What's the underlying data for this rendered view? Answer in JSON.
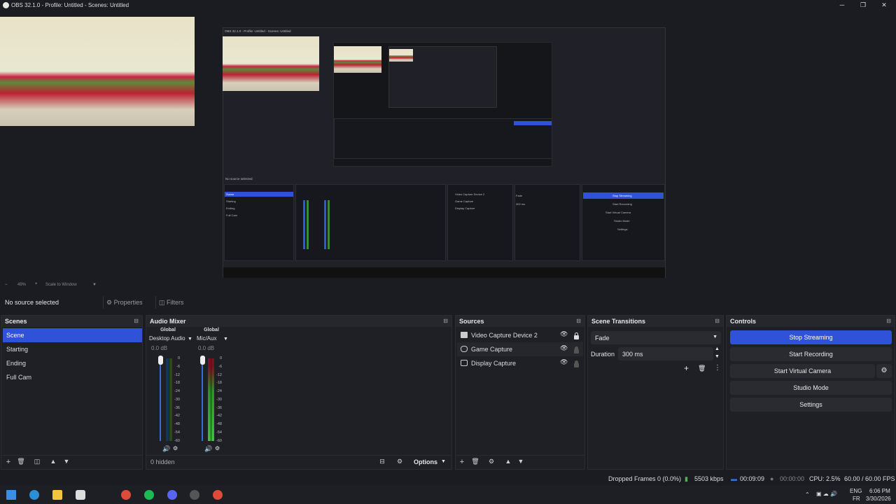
{
  "window": {
    "title": "OBS 32.1.0 - Profile: Untitled - Scenes: Untitled",
    "minimize": "─",
    "restore": "❐",
    "close": "✕"
  },
  "preview": {
    "inner_title": "OBS 32.1.0 - Profile: Untitled - Scenes: Untitled",
    "inner_no_source": "No source selected",
    "inner_scenes": [
      "Scene",
      "Starting",
      "Ending",
      "Full Cam"
    ],
    "inner_sources": [
      "Video Capture Device 2",
      "Game Capture",
      "Display Capture"
    ],
    "inner_controls": [
      "Stop Streaming",
      "Start Recording",
      "Start Virtual Camera",
      "Studio Mode",
      "Settings"
    ],
    "inner_transition": "Fade",
    "inner_duration": "300 ms"
  },
  "zoom": {
    "level": "49%",
    "mode": "Scale to Window"
  },
  "source_bar": {
    "no_source": "No source selected",
    "properties": "Properties",
    "filters": "Filters"
  },
  "scenes": {
    "title": "Scenes",
    "items": [
      "Scene",
      "Starting",
      "Ending",
      "Full Cam"
    ],
    "selected": "Scene"
  },
  "audio_mixer": {
    "title": "Audio Mixer",
    "channels": [
      {
        "group": "Global",
        "name": "Desktop Audio",
        "db": "0.0 dB"
      },
      {
        "group": "Global",
        "name": "Mic/Aux",
        "db": "0.0 dB"
      }
    ],
    "scale": [
      "0",
      "-6",
      "-12",
      "-18",
      "-24",
      "-30",
      "-36",
      "-42",
      "-48",
      "-54",
      "-60"
    ],
    "hidden": "0 hidden",
    "options": "Options"
  },
  "sources": {
    "title": "Sources",
    "items": [
      "Video Capture Device 2",
      "Game Capture",
      "Display Capture"
    ]
  },
  "transitions": {
    "title": "Scene Transitions",
    "selected": "Fade",
    "duration_label": "Duration",
    "duration_value": "300 ms"
  },
  "controls": {
    "title": "Controls",
    "stop_streaming": "Stop Streaming",
    "start_recording": "Start Recording",
    "start_virtual_camera": "Start Virtual Camera",
    "studio_mode": "Studio Mode",
    "settings": "Settings"
  },
  "status": {
    "dropped": "Dropped Frames 0 (0.0%)",
    "bitrate": "5503 kbps",
    "stream_time": "00:09:09",
    "rec_time": "00:00:00",
    "cpu": "CPU: 2.5%",
    "fps": "60.00 / 60.00 FPS"
  },
  "taskbar": {
    "lang1": "ENG",
    "lang2": "FR",
    "time": "6:06 PM",
    "date": "3/30/2026"
  },
  "colors": {
    "accent": "#2f52d8",
    "bg": "#1b1c21",
    "dock": "#1f2026"
  }
}
